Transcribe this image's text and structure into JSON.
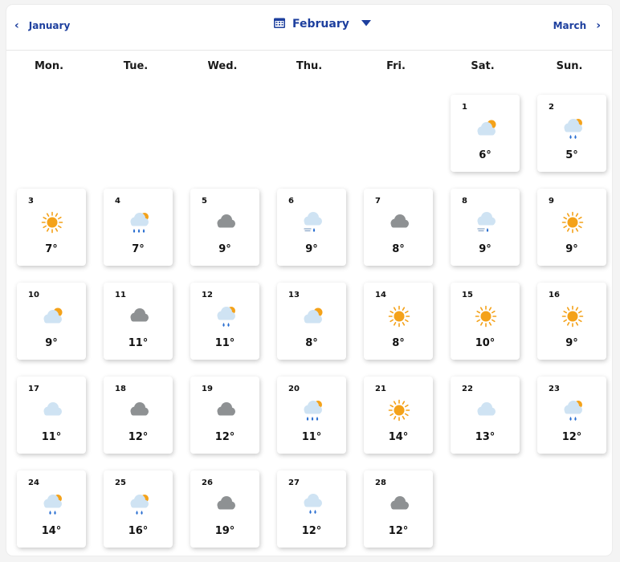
{
  "nav": {
    "prev_label": "January",
    "current_label": "February",
    "next_label": "March"
  },
  "weekdays": [
    "Mon.",
    "Tue.",
    "Wed.",
    "Thu.",
    "Fri.",
    "Sat.",
    "Sun."
  ],
  "first_weekday_index": 5,
  "colors": {
    "accent": "#1d3f9e",
    "sun": "#f4a21a",
    "cloud_light": "#cfe3f3",
    "cloud_dark": "#8e9193",
    "rain": "#2b6fd1"
  },
  "days": [
    {
      "day": "1",
      "temp": "6°",
      "icon": "partly-cloudy-icon"
    },
    {
      "day": "2",
      "temp": "5°",
      "icon": "partly-cloudy-rain-icon"
    },
    {
      "day": "3",
      "temp": "7°",
      "icon": "sun-icon"
    },
    {
      "day": "4",
      "temp": "7°",
      "icon": "partly-cloudy-heavy-rain-icon"
    },
    {
      "day": "5",
      "temp": "9°",
      "icon": "overcast-cloud-icon"
    },
    {
      "day": "6",
      "temp": "9°",
      "icon": "cloud-wind-rain-icon"
    },
    {
      "day": "7",
      "temp": "8°",
      "icon": "overcast-cloud-icon"
    },
    {
      "day": "8",
      "temp": "9°",
      "icon": "cloud-wind-rain-icon"
    },
    {
      "day": "9",
      "temp": "9°",
      "icon": "sun-icon"
    },
    {
      "day": "10",
      "temp": "9°",
      "icon": "partly-cloudy-icon"
    },
    {
      "day": "11",
      "temp": "11°",
      "icon": "overcast-cloud-icon"
    },
    {
      "day": "12",
      "temp": "11°",
      "icon": "partly-cloudy-rain-icon"
    },
    {
      "day": "13",
      "temp": "8°",
      "icon": "partly-cloudy-icon"
    },
    {
      "day": "14",
      "temp": "8°",
      "icon": "sun-icon"
    },
    {
      "day": "15",
      "temp": "10°",
      "icon": "sun-icon"
    },
    {
      "day": "16",
      "temp": "9°",
      "icon": "sun-icon"
    },
    {
      "day": "17",
      "temp": "11°",
      "icon": "light-cloud-icon"
    },
    {
      "day": "18",
      "temp": "12°",
      "icon": "overcast-cloud-icon"
    },
    {
      "day": "19",
      "temp": "12°",
      "icon": "overcast-cloud-icon"
    },
    {
      "day": "20",
      "temp": "11°",
      "icon": "partly-cloudy-heavy-rain-icon"
    },
    {
      "day": "21",
      "temp": "14°",
      "icon": "sun-icon"
    },
    {
      "day": "22",
      "temp": "13°",
      "icon": "light-cloud-icon"
    },
    {
      "day": "23",
      "temp": "12°",
      "icon": "partly-cloudy-rain-icon"
    },
    {
      "day": "24",
      "temp": "14°",
      "icon": "partly-cloudy-rain-icon"
    },
    {
      "day": "25",
      "temp": "16°",
      "icon": "partly-cloudy-rain-icon"
    },
    {
      "day": "26",
      "temp": "19°",
      "icon": "overcast-cloud-icon"
    },
    {
      "day": "27",
      "temp": "12°",
      "icon": "cloud-rain-icon"
    },
    {
      "day": "28",
      "temp": "12°",
      "icon": "overcast-cloud-icon"
    }
  ]
}
